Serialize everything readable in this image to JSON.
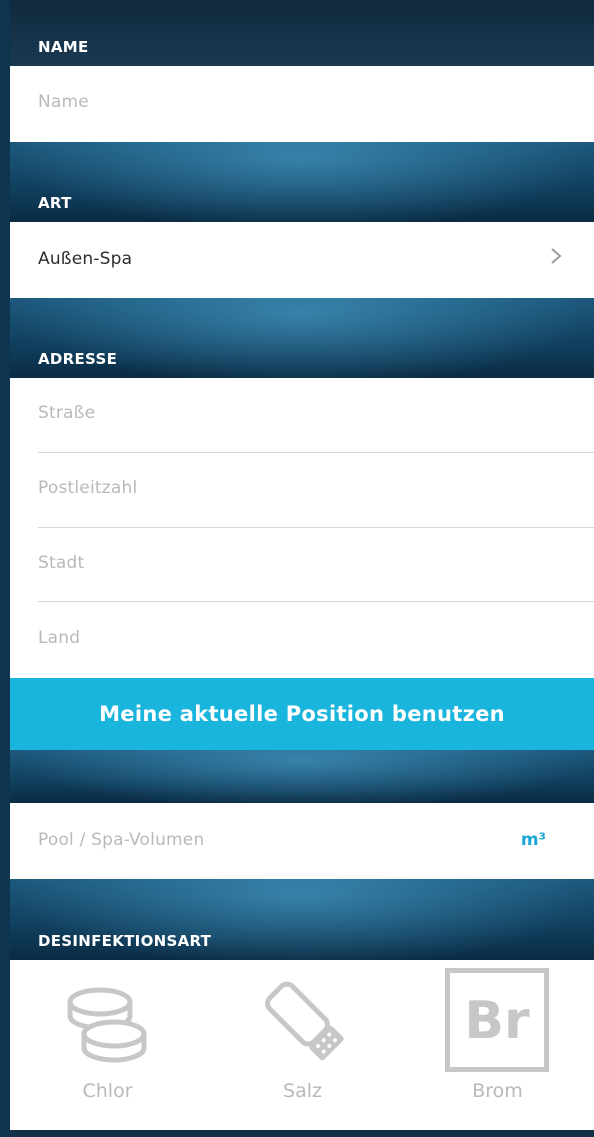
{
  "sections": {
    "name": {
      "title": "NAME",
      "placeholder": "Name"
    },
    "art": {
      "title": "ART",
      "value": "Außen-Spa"
    },
    "adresse": {
      "title": "ADRESSE",
      "fields": [
        "Straße",
        "Postleitzahl",
        "Stadt",
        "Land"
      ]
    },
    "use_location_button": "Meine aktuelle Position benutzen",
    "volume": {
      "placeholder": "Pool / Spa-Volumen",
      "unit": "m³"
    },
    "desinfektion": {
      "title": "DESINFEKTIONSART",
      "options": [
        {
          "label": "Chlor",
          "icon": "chlorine-tablets-icon"
        },
        {
          "label": "Salz",
          "icon": "salt-shaker-icon"
        },
        {
          "label": "Brom",
          "icon": "bromine-element-icon",
          "symbol": "Br"
        }
      ]
    }
  },
  "colors": {
    "accent": "#1ab5dd",
    "unit": "#1aa6d6",
    "placeholder": "#b9b9b9",
    "header_band": "#0f3c5a"
  }
}
